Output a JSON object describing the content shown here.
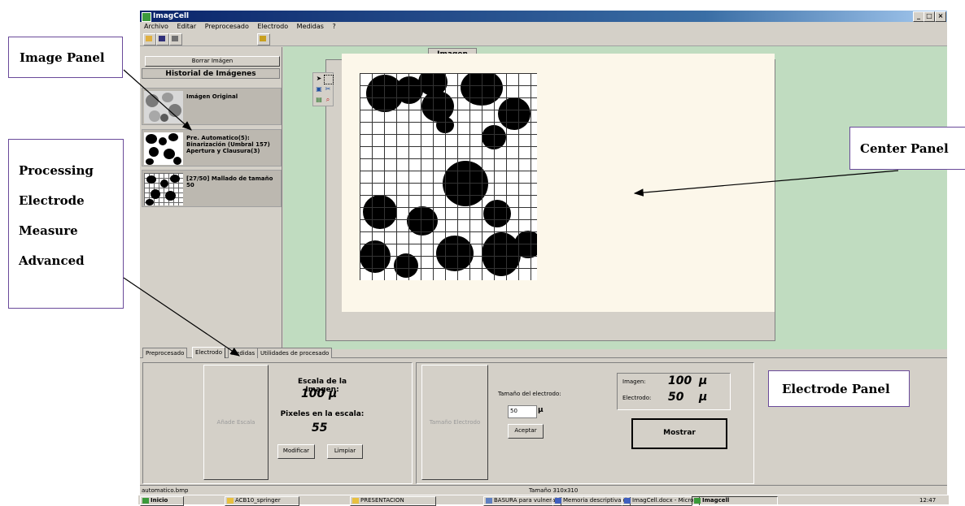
{
  "window": {
    "title": "ImagCell"
  },
  "menu": [
    "Archivo",
    "Editar",
    "Preprocesado",
    "Electrodo",
    "Medidas",
    "?"
  ],
  "left": {
    "borrar_button": "Borrar Imágen",
    "history_title": "Historial de Imágenes",
    "items": [
      {
        "label": "Imágen Original",
        "icon": "original-thumbnail-icon"
      },
      {
        "label": "Pre. Automatico(5): Binarización (Umbral 157) Apertura y Clausura(3)",
        "icon": "binarized-thumbnail-icon"
      },
      {
        "label": "[27/50] Mallado de tamaño 50",
        "icon": "mesh-thumbnail-icon"
      }
    ]
  },
  "center": {
    "tab_label": "Imagen"
  },
  "tabs": [
    "Preprocesado",
    "Electrodo",
    "Medidas",
    "Utilidades de procesado"
  ],
  "electrode": {
    "add_scale_button": "Añade Escala",
    "scale_label": "Escala de la Imagen:",
    "scale_value": "100",
    "scale_unit": "μ",
    "pixels_label": "Pixeles en la escala:",
    "pixels_value": "55",
    "modify_button": "Modificar",
    "clear_button": "Limpiar",
    "size_button": "Tamaño Electrodo",
    "size_label": "Tamaño del electrodo:",
    "size_input": "50",
    "size_unit": "μ",
    "accept_button": "Aceptar",
    "readout_image_label": "Imagen:",
    "readout_image_value": "100",
    "readout_image_unit": "μ",
    "readout_electrode_label": "Electrodo:",
    "readout_electrode_value": "50",
    "readout_electrode_unit": "μ",
    "show_button": "Mostrar"
  },
  "status": {
    "file": "automatico.bmp",
    "size": "Tamaño 310x310"
  },
  "taskbar": {
    "start": "Inicio",
    "items": [
      "ACB10_springer",
      "PRESENTACION",
      "BASURA para vulnerabilin...",
      "Memoria descriptiva.doc ...",
      "ImagCell.docx - Microsof...",
      "Imagcell"
    ],
    "clock": "12:47"
  },
  "annotations": {
    "image_panel": "Image Panel",
    "center_panel": "Center Panel",
    "electrode_panel": "Electrode Panel",
    "modes": [
      "Processing",
      "Electrode",
      "Measure",
      "Advanced"
    ]
  }
}
